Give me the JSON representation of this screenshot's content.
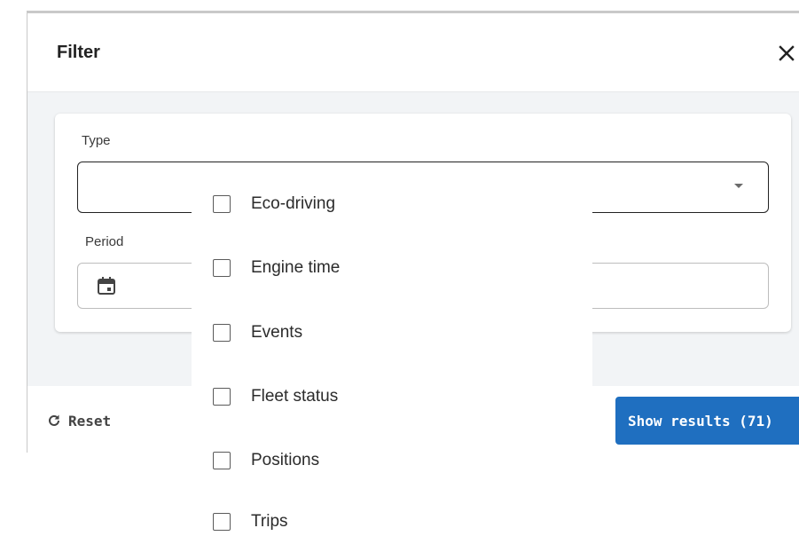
{
  "dialog": {
    "title": "Filter",
    "close_icon": "close-icon"
  },
  "form": {
    "type_label": "Type",
    "type_value": "",
    "period_label": "Period",
    "period_value": "",
    "calendar_icon": "calendar-icon",
    "dropdown_icon": "chevron-down-icon"
  },
  "footer": {
    "reset_label": "Reset",
    "reset_icon": "refresh-icon",
    "show_results_label": "Show results (71)"
  },
  "type_menu": {
    "items": [
      {
        "label": "Eco-driving",
        "checked": false
      },
      {
        "label": "Engine time",
        "checked": false
      },
      {
        "label": "Events",
        "checked": false
      },
      {
        "label": "Fleet status",
        "checked": false
      },
      {
        "label": "Positions",
        "checked": false
      },
      {
        "label": "Trips",
        "checked": false
      }
    ]
  },
  "colors": {
    "primary": "#1f6fc0",
    "body_background": "#f2f4f6"
  }
}
